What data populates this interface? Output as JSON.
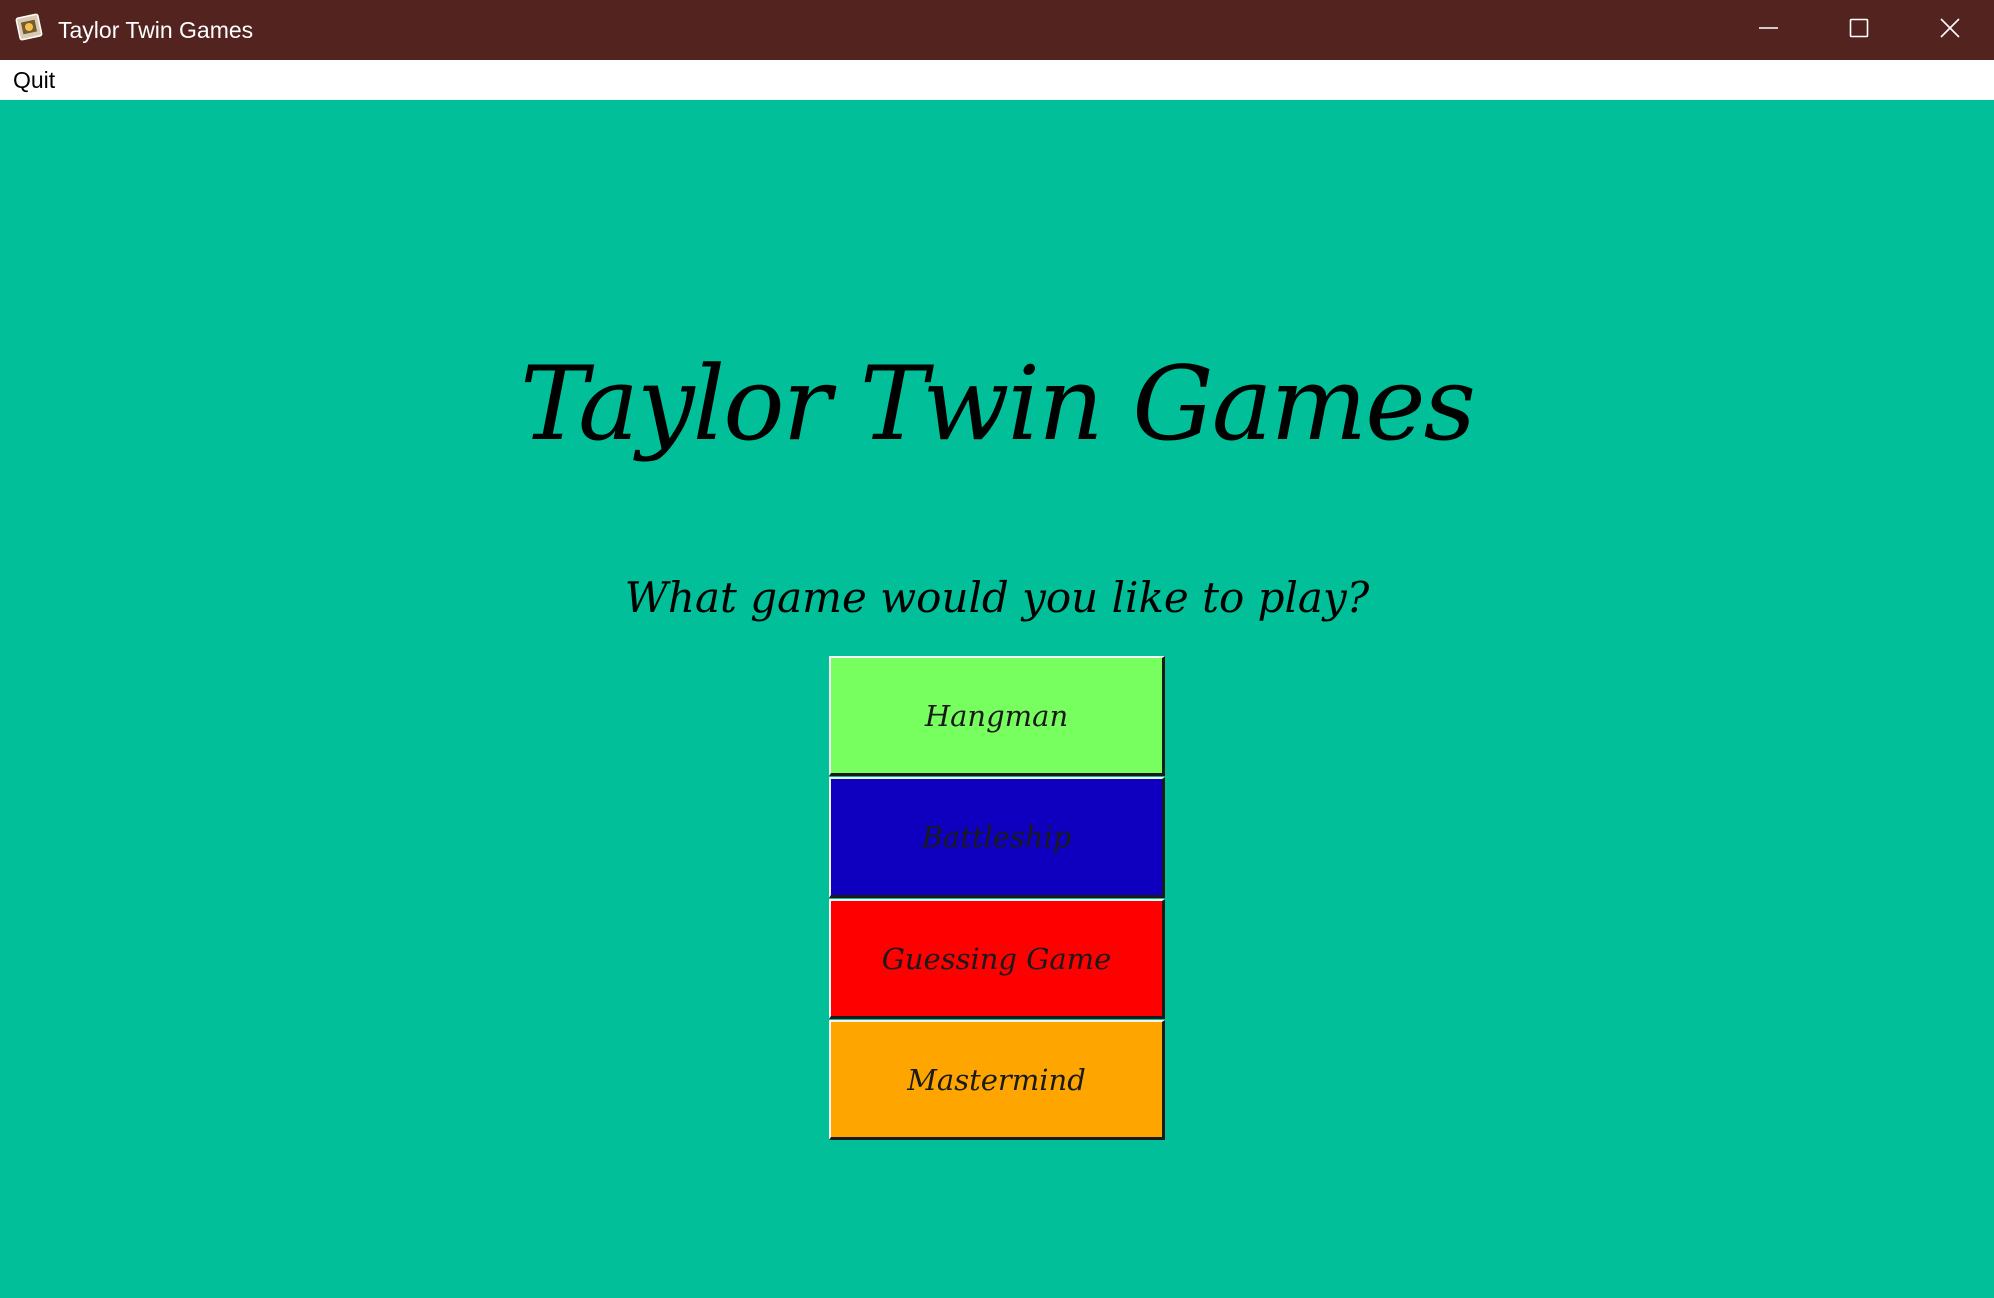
{
  "window": {
    "title": "Taylor Twin Games",
    "titlebar_color": "#532320",
    "background_color": "#00BF99",
    "controls": {
      "minimize": "minimize-icon",
      "maximize": "maximize-icon",
      "close": "close-icon"
    },
    "app_icon": "app-icon"
  },
  "menubar": {
    "items": [
      {
        "label": "Quit"
      }
    ]
  },
  "main": {
    "title": "Taylor Twin Games",
    "prompt": "What game would you like to play?",
    "games": [
      {
        "label": "Hangman",
        "color": "#77FF5F"
      },
      {
        "label": "Battleship",
        "color": "#0E00BE"
      },
      {
        "label": "Guessing Game",
        "color": "#FF0000"
      },
      {
        "label": "Mastermind",
        "color": "#FFA500"
      }
    ]
  }
}
